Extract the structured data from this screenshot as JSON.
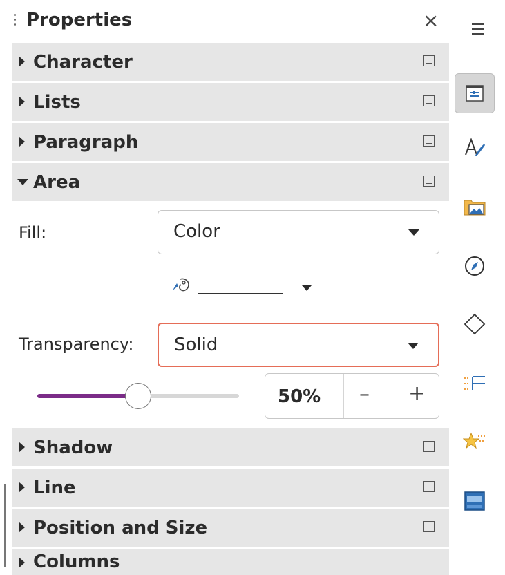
{
  "panel": {
    "title": "Properties",
    "close_glyph": "×"
  },
  "sections": {
    "character": "Character",
    "lists": "Lists",
    "paragraph": "Paragraph",
    "area": "Area",
    "shadow": "Shadow",
    "line": "Line",
    "position_size": "Position and Size",
    "columns": "Columns"
  },
  "area": {
    "fill_label": "Fill:",
    "fill_value": "Color",
    "fill_color": "#ffffff",
    "transparency_label": "Transparency:",
    "transparency_value": "Solid",
    "transparency_percent": "50%",
    "slider_fraction": 0.5,
    "minus_glyph": "–",
    "plus_glyph": "+"
  },
  "colors": {
    "section_bg": "#e6e6e6",
    "focus_border": "#e56d57",
    "slider_fill": "#7b2c88",
    "accent_blue": "#2f6fb5"
  },
  "sidebar_icons": [
    "hamburger-menu-icon",
    "properties-icon",
    "styles-icon",
    "gallery-icon",
    "navigator-icon",
    "shapes-icon",
    "animation-icon",
    "slide-transition-icon",
    "master-slides-icon"
  ]
}
